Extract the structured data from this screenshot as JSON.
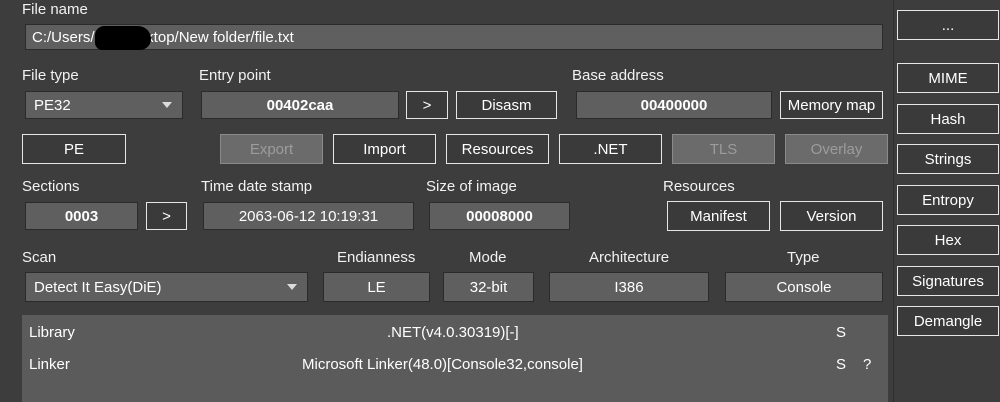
{
  "file": {
    "label": "File name",
    "path": "C:/Users/      Desktop/New folder/file.txt"
  },
  "file_type": {
    "label": "File type",
    "value": "PE32"
  },
  "entry_point": {
    "label": "Entry point",
    "value": "00402caa",
    "go": ">",
    "disasm": "Disasm"
  },
  "base_address": {
    "label": "Base address",
    "value": "00400000",
    "memory_map": "Memory map"
  },
  "sections_row": {
    "pe": "PE",
    "export": "Export",
    "import": "Import",
    "resources": "Resources",
    "net": ".NET",
    "tls": "TLS",
    "overlay": "Overlay"
  },
  "sections": {
    "label": "Sections",
    "value": "0003",
    "go": ">"
  },
  "timestamp": {
    "label": "Time date stamp",
    "value": "2063-06-12 10:19:31"
  },
  "size_of_image": {
    "label": "Size of image",
    "value": "00008000"
  },
  "resources": {
    "label": "Resources",
    "manifest": "Manifest",
    "version": "Version"
  },
  "scan": {
    "label": "Scan",
    "engine": "Detect It Easy(DiE)"
  },
  "endianness": {
    "label": "Endianness",
    "value": "LE"
  },
  "mode": {
    "label": "Mode",
    "value": "32-bit"
  },
  "architecture": {
    "label": "Architecture",
    "value": "I386"
  },
  "type": {
    "label": "Type",
    "value": "Console"
  },
  "results": [
    {
      "kind": "Library",
      "name": ".NET(v4.0.30319)[-]",
      "flag": "S",
      "extra": ""
    },
    {
      "kind": "Linker",
      "name": "Microsoft Linker(48.0)[Console32,console]",
      "flag": "S",
      "extra": "?"
    }
  ],
  "sidebar": {
    "more": "...",
    "mime": "MIME",
    "hash": "Hash",
    "strings": "Strings",
    "entropy": "Entropy",
    "hex": "Hex",
    "signatures": "Signatures",
    "demangle": "Demangle"
  }
}
